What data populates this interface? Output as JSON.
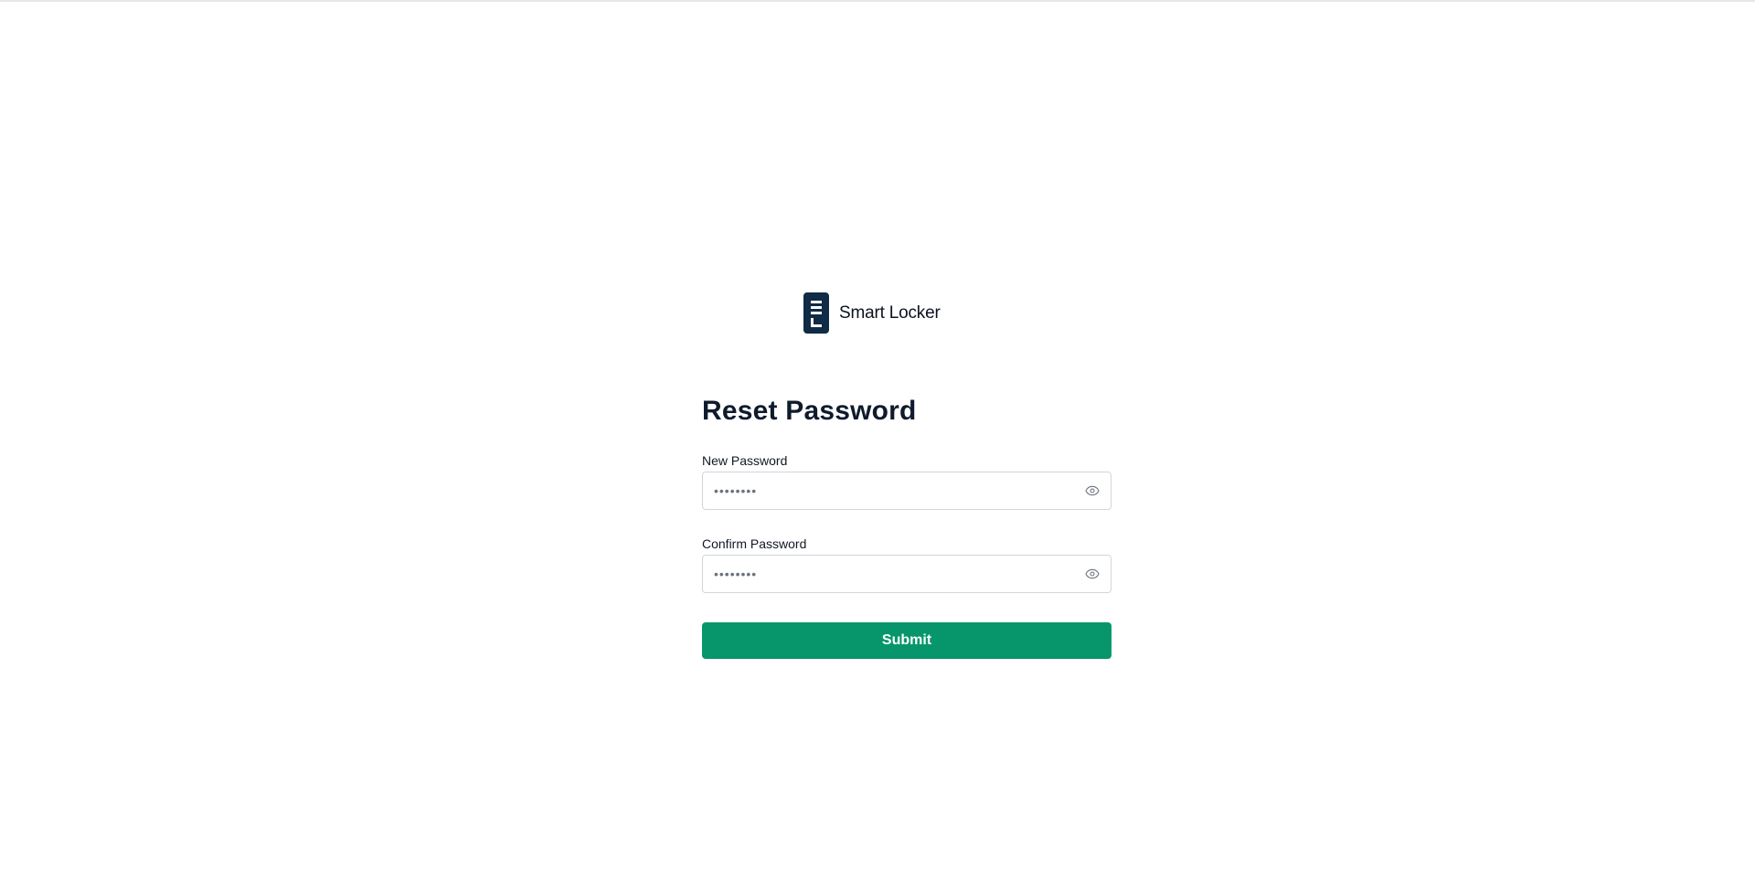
{
  "brand": {
    "name": "Smart Locker",
    "logo_icon": "locker-logo-icon",
    "logo_color": "#0f2b46"
  },
  "form": {
    "title": "Reset Password",
    "new_password": {
      "label": "New Password",
      "placeholder": "••••••••",
      "value": "",
      "toggle_icon": "eye-icon"
    },
    "confirm_password": {
      "label": "Confirm Password",
      "placeholder": "••••••••",
      "value": "",
      "toggle_icon": "eye-icon"
    },
    "submit_label": "Submit",
    "submit_color": "#07966b"
  }
}
